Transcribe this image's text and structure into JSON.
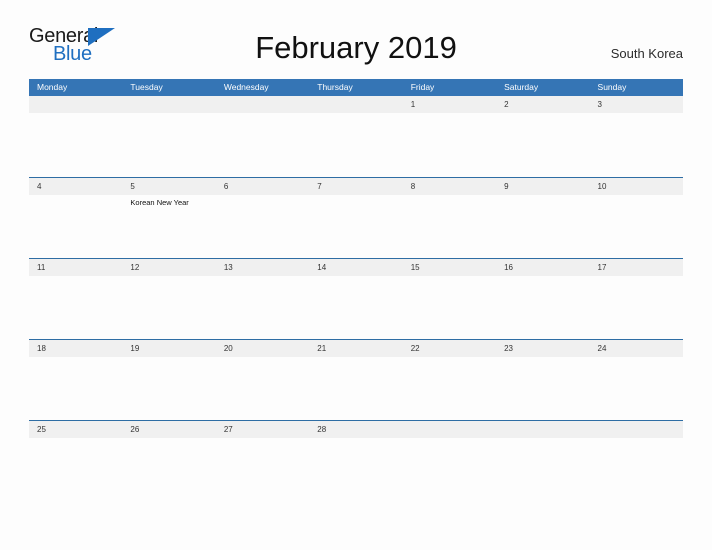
{
  "brand": {
    "name_part1": "General",
    "name_part2": "Blue",
    "logo_icon": "blue-triangle-flag",
    "accent_color": "#1f6fc0"
  },
  "header": {
    "title": "February 2019",
    "region": "South Korea"
  },
  "colors": {
    "header_blue": "#3575b5",
    "row_divider_blue": "#2e6da4",
    "date_band_gray": "#f0f0f0",
    "page_background": "#fdfdfd"
  },
  "calendar": {
    "month": "February",
    "year": "2019",
    "weekday_headers": [
      "Monday",
      "Tuesday",
      "Wednesday",
      "Thursday",
      "Friday",
      "Saturday",
      "Sunday"
    ],
    "weeks": [
      {
        "days": [
          {
            "date": "",
            "events": []
          },
          {
            "date": "",
            "events": []
          },
          {
            "date": "",
            "events": []
          },
          {
            "date": "",
            "events": []
          },
          {
            "date": "1",
            "events": []
          },
          {
            "date": "2",
            "events": []
          },
          {
            "date": "3",
            "events": []
          }
        ]
      },
      {
        "days": [
          {
            "date": "4",
            "events": []
          },
          {
            "date": "5",
            "events": [
              "Korean New Year"
            ]
          },
          {
            "date": "6",
            "events": []
          },
          {
            "date": "7",
            "events": []
          },
          {
            "date": "8",
            "events": []
          },
          {
            "date": "9",
            "events": []
          },
          {
            "date": "10",
            "events": []
          }
        ]
      },
      {
        "days": [
          {
            "date": "11",
            "events": []
          },
          {
            "date": "12",
            "events": []
          },
          {
            "date": "13",
            "events": []
          },
          {
            "date": "14",
            "events": []
          },
          {
            "date": "15",
            "events": []
          },
          {
            "date": "16",
            "events": []
          },
          {
            "date": "17",
            "events": []
          }
        ]
      },
      {
        "days": [
          {
            "date": "18",
            "events": []
          },
          {
            "date": "19",
            "events": []
          },
          {
            "date": "20",
            "events": []
          },
          {
            "date": "21",
            "events": []
          },
          {
            "date": "22",
            "events": []
          },
          {
            "date": "23",
            "events": []
          },
          {
            "date": "24",
            "events": []
          }
        ]
      },
      {
        "days": [
          {
            "date": "25",
            "events": []
          },
          {
            "date": "26",
            "events": []
          },
          {
            "date": "27",
            "events": []
          },
          {
            "date": "28",
            "events": []
          },
          {
            "date": "",
            "events": []
          },
          {
            "date": "",
            "events": []
          },
          {
            "date": "",
            "events": []
          }
        ]
      }
    ]
  }
}
